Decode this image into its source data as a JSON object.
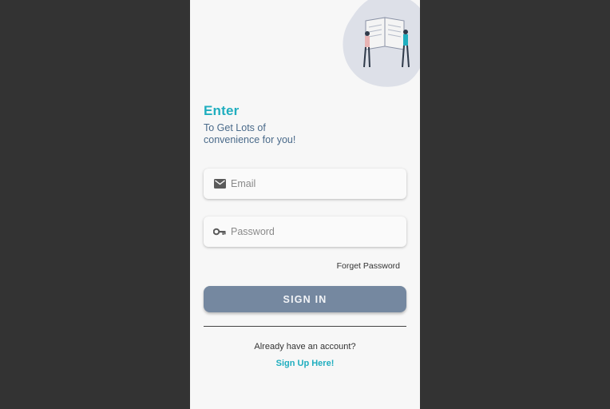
{
  "welcome": {
    "title": "Enter",
    "subtitle": "To Get Lots of convenience for you!"
  },
  "form": {
    "email": {
      "placeholder": "Email",
      "value": "",
      "icon": "mail-icon"
    },
    "password": {
      "placeholder": "Password",
      "value": "",
      "icon": "key-icon"
    },
    "forget_label": "Forget Password",
    "signin_label": "SIGN IN"
  },
  "footer": {
    "prompt": "Already have an account?",
    "signup_label": "Sign Up Here!"
  },
  "colors": {
    "accent": "#20aebf",
    "button": "#7588a0",
    "background": "#333333",
    "screen": "#f7f7f7"
  }
}
